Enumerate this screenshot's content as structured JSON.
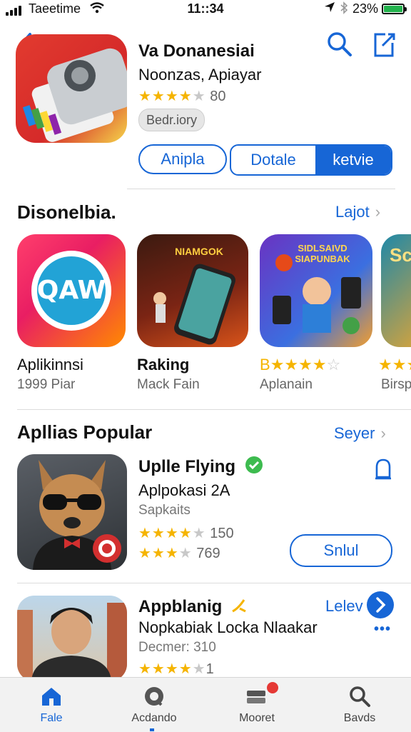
{
  "status_bar": {
    "carrier": "Taeetime",
    "time": "11::34",
    "battery": "23%"
  },
  "hero": {
    "title": "Va Donanesiai",
    "subtitle": "Noonzas, Apiayar",
    "stars_filled": 4,
    "stars_total": 5,
    "rating_count": "80",
    "chip": "Bedr.iory",
    "button_primary": "Anipla",
    "segment_left": "Dotale",
    "segment_right": "ketvie"
  },
  "section1": {
    "title": "Disonelbia.",
    "link": "Lajot",
    "tiles": [
      {
        "label": "Aplikinnsi",
        "sub": "1999 Piar",
        "logo_text": "QAW"
      },
      {
        "label": "Raking",
        "sub": "Mack Fain",
        "banner": "NIAMGOK"
      },
      {
        "label": "B",
        "stars": "★★★★",
        "empty": "☆",
        "sub": "Aplanain",
        "banner": "SIDLSAIVD SIAPUNBAK"
      },
      {
        "label": "",
        "stars": "★★★",
        "sub": "Birsp",
        "banner": "Sc"
      }
    ]
  },
  "section2": {
    "title": "Apllias Popular",
    "link": "Seyer",
    "rows": [
      {
        "title": "Uplle Flying",
        "sub": "Aplpokasi 2A",
        "meta": "Sapkaits",
        "rating1_count": "150",
        "rating2_count": "769",
        "button": "Snlul"
      },
      {
        "title": "Appblanig",
        "sub": "Nopkabiak Locka Nlaakar",
        "meta": "Decmer: 310",
        "rating_count": "1",
        "link": "Lelev"
      }
    ]
  },
  "tabs": [
    {
      "label": "Fale",
      "icon": "home-icon",
      "active": true
    },
    {
      "label": "Acdando",
      "icon": "apps-icon",
      "active": false
    },
    {
      "label": "Mooret",
      "icon": "cards-icon",
      "active": false
    },
    {
      "label": "Bavds",
      "icon": "search-icon",
      "active": false
    }
  ],
  "colors": {
    "accent": "#1766d6",
    "star": "#f5b400",
    "battery": "#22b24c",
    "badge": "#e53935"
  }
}
